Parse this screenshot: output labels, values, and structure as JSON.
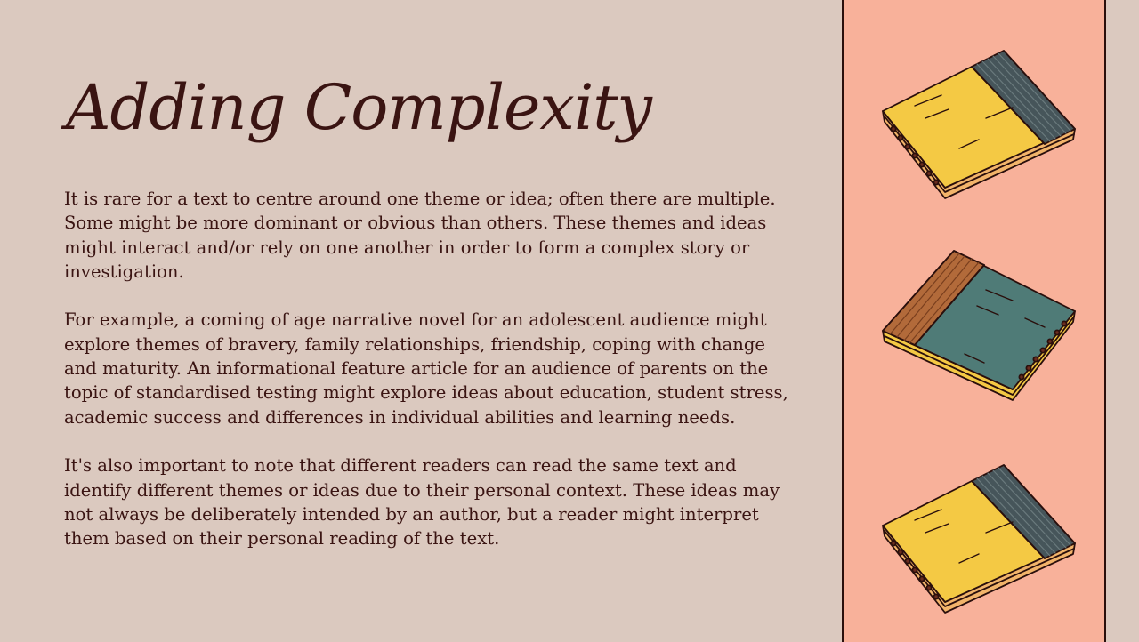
{
  "slide": {
    "title": "Adding Complexity",
    "paragraphs": [
      "It is rare for a text to centre around one theme or idea; often there are multiple. Some might be more dominant or obvious than others. These themes and ideas might interact and/or rely on one another in order to form a complex story or investigation.",
      "For example, a coming of age narrative novel for an adolescent audience might explore themes of bravery, family relationships, friendship, coping with change and maturity. An informational feature article for an audience of parents on the topic of standardised testing might explore ideas about education, student stress, academic success and differences in individual abilities and learning needs.",
      "It's also important to note that different readers can read the same text and identify different themes or ideas due to their personal context. These ideas may not always be deliberately intended by an author, but a reader might interpret them based on their personal reading of the text."
    ]
  },
  "colors": {
    "background": "#dbc9bf",
    "panel": "#f8b19a",
    "text": "#3a1412",
    "notebook_yellow": "#f4c944",
    "notebook_teal": "#4f7b77",
    "notebook_stripe_dark": "#46555a",
    "notebook_stripe_brown": "#b26a3a"
  },
  "decorations": [
    {
      "icon": "yellow-notebook-icon"
    },
    {
      "icon": "teal-notebook-icon"
    },
    {
      "icon": "yellow-notebook-icon"
    }
  ]
}
